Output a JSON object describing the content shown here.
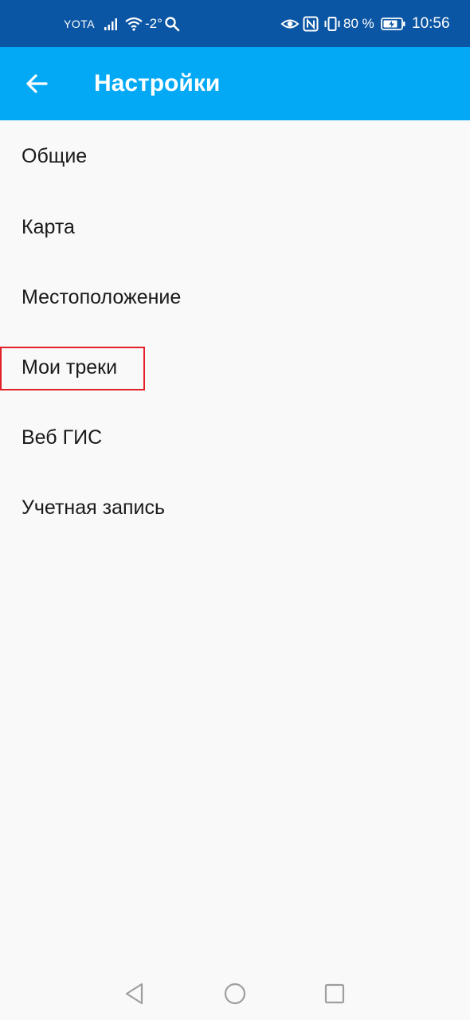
{
  "status_bar": {
    "carrier": "YOTA",
    "temperature": "-2°",
    "battery_percent": "80 %",
    "time": "10:56",
    "icons": [
      "signal-icon",
      "wifi-icon",
      "search-icon",
      "eye-icon",
      "nfc-icon",
      "vibrate-icon",
      "battery-icon"
    ]
  },
  "app_bar": {
    "title": "Настройки",
    "back_icon": "arrow-left-icon"
  },
  "settings": {
    "items": [
      {
        "label": "Общие"
      },
      {
        "label": "Карта"
      },
      {
        "label": "Местоположение"
      },
      {
        "label": "Мои треки"
      },
      {
        "label": "Веб ГИС"
      },
      {
        "label": "Учетная запись"
      }
    ]
  },
  "nav_bar": {
    "icons": [
      "nav-back-icon",
      "nav-home-icon",
      "nav-recents-icon"
    ]
  },
  "colors": {
    "status_bar": "#0b56a4",
    "app_bar": "#03a9f4",
    "background": "#f9f9f9",
    "highlight": "#e32028"
  }
}
